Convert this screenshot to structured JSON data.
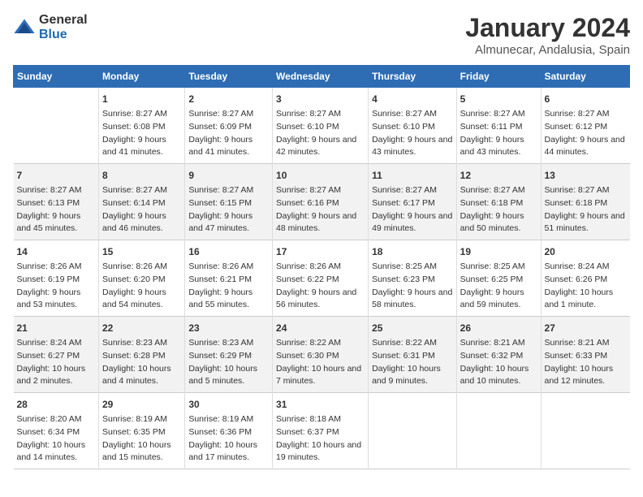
{
  "logo": {
    "general": "General",
    "blue": "Blue"
  },
  "title": "January 2024",
  "subtitle": "Almunecar, Andalusia, Spain",
  "headers": [
    "Sunday",
    "Monday",
    "Tuesday",
    "Wednesday",
    "Thursday",
    "Friday",
    "Saturday"
  ],
  "weeks": [
    [
      {
        "day": "",
        "sunrise": "",
        "sunset": "",
        "daylight": ""
      },
      {
        "day": "1",
        "sunrise": "Sunrise: 8:27 AM",
        "sunset": "Sunset: 6:08 PM",
        "daylight": "Daylight: 9 hours and 41 minutes."
      },
      {
        "day": "2",
        "sunrise": "Sunrise: 8:27 AM",
        "sunset": "Sunset: 6:09 PM",
        "daylight": "Daylight: 9 hours and 41 minutes."
      },
      {
        "day": "3",
        "sunrise": "Sunrise: 8:27 AM",
        "sunset": "Sunset: 6:10 PM",
        "daylight": "Daylight: 9 hours and 42 minutes."
      },
      {
        "day": "4",
        "sunrise": "Sunrise: 8:27 AM",
        "sunset": "Sunset: 6:10 PM",
        "daylight": "Daylight: 9 hours and 43 minutes."
      },
      {
        "day": "5",
        "sunrise": "Sunrise: 8:27 AM",
        "sunset": "Sunset: 6:11 PM",
        "daylight": "Daylight: 9 hours and 43 minutes."
      },
      {
        "day": "6",
        "sunrise": "Sunrise: 8:27 AM",
        "sunset": "Sunset: 6:12 PM",
        "daylight": "Daylight: 9 hours and 44 minutes."
      }
    ],
    [
      {
        "day": "7",
        "sunrise": "Sunrise: 8:27 AM",
        "sunset": "Sunset: 6:13 PM",
        "daylight": "Daylight: 9 hours and 45 minutes."
      },
      {
        "day": "8",
        "sunrise": "Sunrise: 8:27 AM",
        "sunset": "Sunset: 6:14 PM",
        "daylight": "Daylight: 9 hours and 46 minutes."
      },
      {
        "day": "9",
        "sunrise": "Sunrise: 8:27 AM",
        "sunset": "Sunset: 6:15 PM",
        "daylight": "Daylight: 9 hours and 47 minutes."
      },
      {
        "day": "10",
        "sunrise": "Sunrise: 8:27 AM",
        "sunset": "Sunset: 6:16 PM",
        "daylight": "Daylight: 9 hours and 48 minutes."
      },
      {
        "day": "11",
        "sunrise": "Sunrise: 8:27 AM",
        "sunset": "Sunset: 6:17 PM",
        "daylight": "Daylight: 9 hours and 49 minutes."
      },
      {
        "day": "12",
        "sunrise": "Sunrise: 8:27 AM",
        "sunset": "Sunset: 6:18 PM",
        "daylight": "Daylight: 9 hours and 50 minutes."
      },
      {
        "day": "13",
        "sunrise": "Sunrise: 8:27 AM",
        "sunset": "Sunset: 6:18 PM",
        "daylight": "Daylight: 9 hours and 51 minutes."
      }
    ],
    [
      {
        "day": "14",
        "sunrise": "Sunrise: 8:26 AM",
        "sunset": "Sunset: 6:19 PM",
        "daylight": "Daylight: 9 hours and 53 minutes."
      },
      {
        "day": "15",
        "sunrise": "Sunrise: 8:26 AM",
        "sunset": "Sunset: 6:20 PM",
        "daylight": "Daylight: 9 hours and 54 minutes."
      },
      {
        "day": "16",
        "sunrise": "Sunrise: 8:26 AM",
        "sunset": "Sunset: 6:21 PM",
        "daylight": "Daylight: 9 hours and 55 minutes."
      },
      {
        "day": "17",
        "sunrise": "Sunrise: 8:26 AM",
        "sunset": "Sunset: 6:22 PM",
        "daylight": "Daylight: 9 hours and 56 minutes."
      },
      {
        "day": "18",
        "sunrise": "Sunrise: 8:25 AM",
        "sunset": "Sunset: 6:23 PM",
        "daylight": "Daylight: 9 hours and 58 minutes."
      },
      {
        "day": "19",
        "sunrise": "Sunrise: 8:25 AM",
        "sunset": "Sunset: 6:25 PM",
        "daylight": "Daylight: 9 hours and 59 minutes."
      },
      {
        "day": "20",
        "sunrise": "Sunrise: 8:24 AM",
        "sunset": "Sunset: 6:26 PM",
        "daylight": "Daylight: 10 hours and 1 minute."
      }
    ],
    [
      {
        "day": "21",
        "sunrise": "Sunrise: 8:24 AM",
        "sunset": "Sunset: 6:27 PM",
        "daylight": "Daylight: 10 hours and 2 minutes."
      },
      {
        "day": "22",
        "sunrise": "Sunrise: 8:23 AM",
        "sunset": "Sunset: 6:28 PM",
        "daylight": "Daylight: 10 hours and 4 minutes."
      },
      {
        "day": "23",
        "sunrise": "Sunrise: 8:23 AM",
        "sunset": "Sunset: 6:29 PM",
        "daylight": "Daylight: 10 hours and 5 minutes."
      },
      {
        "day": "24",
        "sunrise": "Sunrise: 8:22 AM",
        "sunset": "Sunset: 6:30 PM",
        "daylight": "Daylight: 10 hours and 7 minutes."
      },
      {
        "day": "25",
        "sunrise": "Sunrise: 8:22 AM",
        "sunset": "Sunset: 6:31 PM",
        "daylight": "Daylight: 10 hours and 9 minutes."
      },
      {
        "day": "26",
        "sunrise": "Sunrise: 8:21 AM",
        "sunset": "Sunset: 6:32 PM",
        "daylight": "Daylight: 10 hours and 10 minutes."
      },
      {
        "day": "27",
        "sunrise": "Sunrise: 8:21 AM",
        "sunset": "Sunset: 6:33 PM",
        "daylight": "Daylight: 10 hours and 12 minutes."
      }
    ],
    [
      {
        "day": "28",
        "sunrise": "Sunrise: 8:20 AM",
        "sunset": "Sunset: 6:34 PM",
        "daylight": "Daylight: 10 hours and 14 minutes."
      },
      {
        "day": "29",
        "sunrise": "Sunrise: 8:19 AM",
        "sunset": "Sunset: 6:35 PM",
        "daylight": "Daylight: 10 hours and 15 minutes."
      },
      {
        "day": "30",
        "sunrise": "Sunrise: 8:19 AM",
        "sunset": "Sunset: 6:36 PM",
        "daylight": "Daylight: 10 hours and 17 minutes."
      },
      {
        "day": "31",
        "sunrise": "Sunrise: 8:18 AM",
        "sunset": "Sunset: 6:37 PM",
        "daylight": "Daylight: 10 hours and 19 minutes."
      },
      {
        "day": "",
        "sunrise": "",
        "sunset": "",
        "daylight": ""
      },
      {
        "day": "",
        "sunrise": "",
        "sunset": "",
        "daylight": ""
      },
      {
        "day": "",
        "sunrise": "",
        "sunset": "",
        "daylight": ""
      }
    ]
  ]
}
